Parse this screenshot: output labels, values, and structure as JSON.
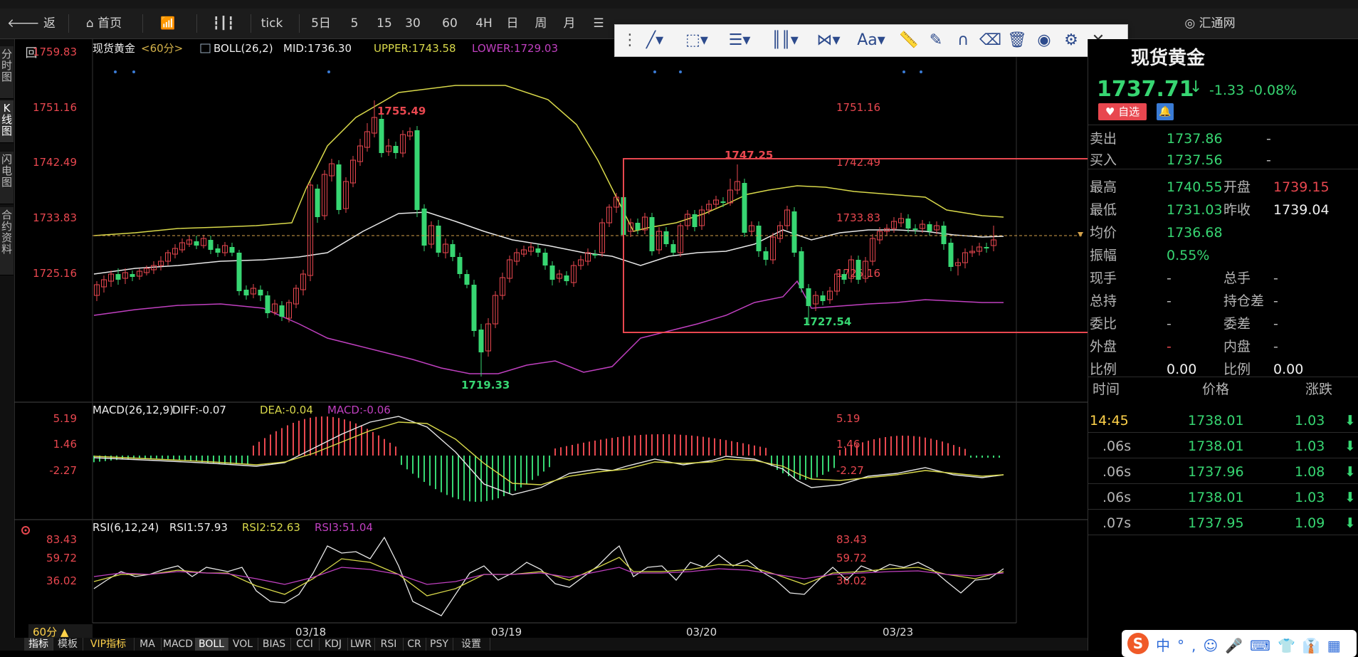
{
  "nav": {
    "back": "返回",
    "home": "首页",
    "tick": "tick",
    "periods": [
      "5日",
      "5",
      "15",
      "30",
      "60",
      "4H",
      "日",
      "周",
      "月"
    ],
    "brand": "汇通网"
  },
  "left_tabs": [
    "分时图",
    "K线图",
    "闪电图",
    "合约资料"
  ],
  "chart": {
    "symbol": "现货黄金",
    "period": "<60分>",
    "boll": {
      "label": "BOLL(26,2)",
      "mid": "MID:1736.30",
      "upper": "UPPER:1743.58",
      "lower": "LOWER:1729.03"
    },
    "price_ticks": [
      "1759.83",
      "1751.16",
      "1742.49",
      "1733.83",
      "1725.16"
    ],
    "annotations": {
      "high": "1755.49",
      "low": "1719.33",
      "box_high": "1747.25",
      "box_low": "1727.54"
    },
    "dates": [
      "03/18",
      "03/19",
      "03/20",
      "03/23"
    ],
    "period_button": "60分 ▲"
  },
  "macd": {
    "label": "MACD(26,12,9)",
    "diff": "DIFF:-0.07",
    "dea": "DEA:-0.04",
    "macd": "MACD:-0.06",
    "ticks": [
      "5.19",
      "1.46",
      "-2.27"
    ]
  },
  "rsi": {
    "label": "RSI(6,12,24)",
    "rsi1": "RSI1:57.93",
    "rsi2": "RSI2:52.63",
    "rsi3": "RSI3:51.04",
    "ticks": [
      "83.43",
      "59.72",
      "36.02"
    ]
  },
  "quote": {
    "title": "现货黄金",
    "price": "1737.71",
    "arrow": "↓",
    "change": "-1.33",
    "change_pct": "-0.08%",
    "fav_button": "自选",
    "rows": [
      {
        "label": "卖出",
        "value": "1737.86",
        "value2": "-"
      },
      {
        "label": "买入",
        "value": "1737.56",
        "value2": "-"
      }
    ],
    "stats": [
      {
        "l1": "最高",
        "v1": "1740.55",
        "l2": "开盘",
        "v2": "1739.15"
      },
      {
        "l1": "最低",
        "v1": "1731.03",
        "l2": "昨收",
        "v2": "1739.04"
      },
      {
        "l1": "均价",
        "v1": "1736.68",
        "l2": "",
        "v2": ""
      },
      {
        "l1": "振幅",
        "v1": "0.55%",
        "l2": "",
        "v2": ""
      },
      {
        "l1": "现手",
        "v1": "-",
        "l2": "总手",
        "v2": "-"
      },
      {
        "l1": "总持",
        "v1": "-",
        "l2": "持仓差",
        "v2": "-"
      },
      {
        "l1": "委比",
        "v1": "-",
        "l2": "委差",
        "v2": "-"
      },
      {
        "l1": "外盘",
        "v1": "-",
        "l2": "内盘",
        "v2": "-"
      },
      {
        "l1": "比例",
        "v1": "0.00",
        "l2": "比例",
        "v2": "0.00"
      }
    ],
    "ticks_header": {
      "time": "时间",
      "price": "价格",
      "change": "涨跌"
    },
    "ticks": [
      {
        "time": "14:45",
        "price": "1738.01",
        "chg": "1.03"
      },
      {
        "time": ".06s",
        "price": "1738.01",
        "chg": "1.03"
      },
      {
        "time": ".06s",
        "price": "1737.96",
        "chg": "1.08"
      },
      {
        "time": ".06s",
        "price": "1738.01",
        "chg": "1.03"
      },
      {
        "time": ".07s",
        "price": "1737.95",
        "chg": "1.09"
      }
    ]
  },
  "bottom_tabs": [
    "指标",
    "模板",
    "VIP指标",
    "MA",
    "MACD",
    "BOLL",
    "VOL",
    "BIAS",
    "CCI",
    "KDJ",
    "LWR",
    "RSI",
    "CR",
    "PSY",
    "设置"
  ],
  "colors": {
    "up": "#e8474f",
    "down": "#37d672",
    "accent": "#ffd24a",
    "boll_lower": "#c040c0"
  }
}
